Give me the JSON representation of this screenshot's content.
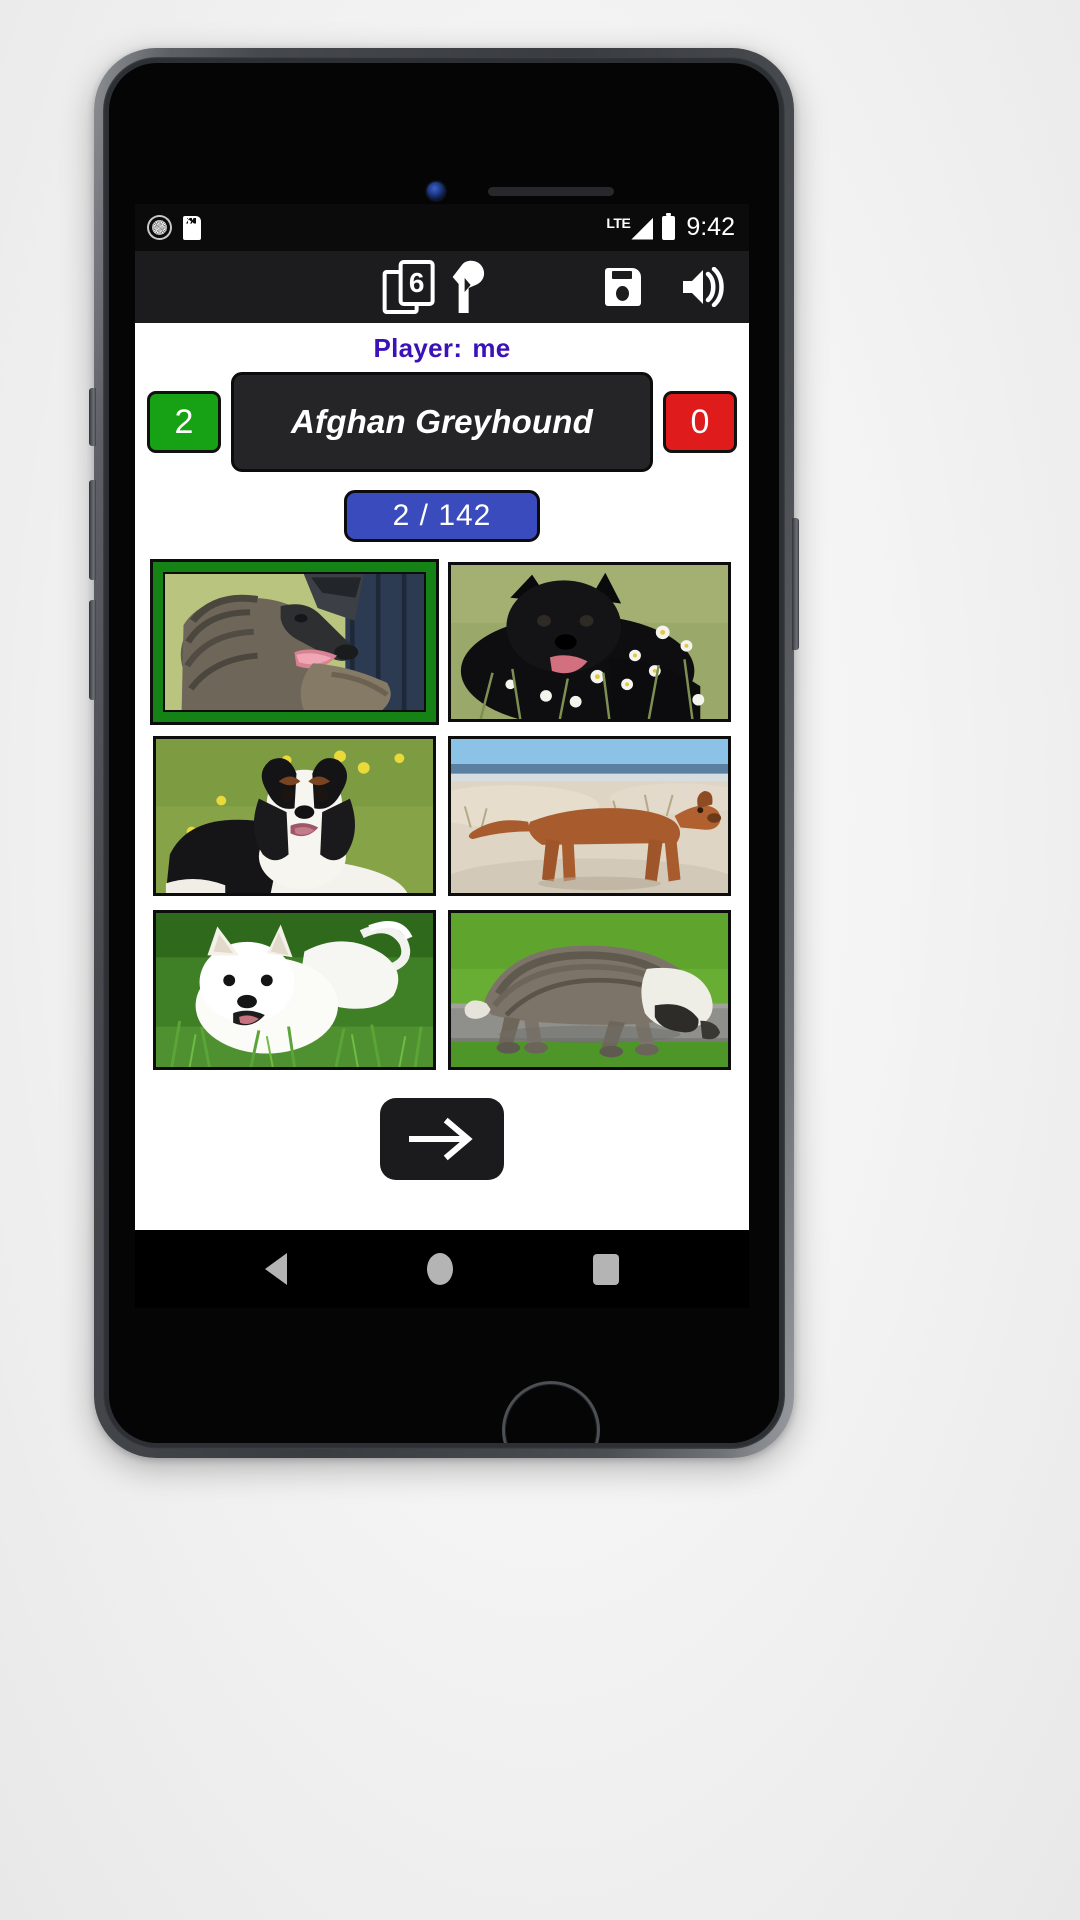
{
  "status_bar": {
    "icons": [
      "sync-icon",
      "sd-card-icon"
    ],
    "network_label": "LTE",
    "time": "9:42"
  },
  "app_toolbar": {
    "cards_count_label": "6",
    "buttons": [
      {
        "name": "cards-deck-button",
        "icon": "cards-stack-6-icon"
      },
      {
        "name": "flag-button",
        "icon": "flag-icon"
      },
      {
        "name": "save-button",
        "icon": "floppy-disk-icon"
      },
      {
        "name": "sound-button",
        "icon": "speaker-volume-icon"
      }
    ]
  },
  "quiz": {
    "player_label": "Player:",
    "player_name": "me",
    "score_correct": "2",
    "score_wrong": "0",
    "answer_text": "Afghan Greyhound",
    "progress_text": "2 / 142",
    "next_label": "next-arrow-icon",
    "colors": {
      "player_text": "#3b11b8",
      "score_correct_bg": "#17a215",
      "score_wrong_bg": "#e01b1b",
      "answer_bg": "#252527",
      "progress_bg": "#3a4bbd",
      "selected_border": "#148214"
    },
    "options": [
      {
        "id": 1,
        "alt": "Afghan Greyhound - long-haired grey dog in profile on grass",
        "selected": true
      },
      {
        "id": 2,
        "alt": "Black Schipperke-type dog lying in grass with daisies",
        "selected": false
      },
      {
        "id": 3,
        "alt": "Cavalier King Charles Spaniel lying on grass with yellow flowers",
        "selected": false
      },
      {
        "id": 4,
        "alt": "Vizsla standing on a sandy beach",
        "selected": false
      },
      {
        "id": 5,
        "alt": "White Spitz dog lying on green grass",
        "selected": false
      },
      {
        "id": 6,
        "alt": "Shaggy grey and white sheepdog walking on a path",
        "selected": false
      }
    ]
  },
  "nav_bar": {
    "back": "back-nav-icon",
    "home": "home-nav-icon",
    "recents": "recents-nav-icon"
  }
}
